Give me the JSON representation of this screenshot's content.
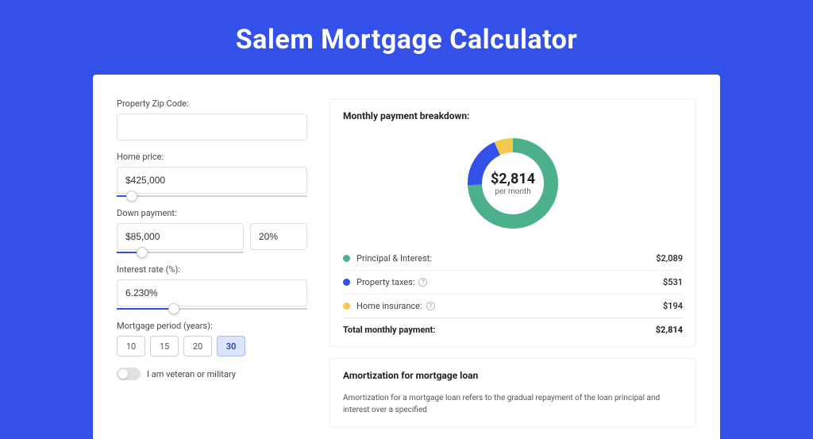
{
  "title": "Salem Mortgage Calculator",
  "colors": {
    "principal": "#4CB08A",
    "taxes": "#3350E8",
    "insurance": "#F3C94B"
  },
  "form": {
    "zip_label": "Property Zip Code:",
    "zip_value": "",
    "price_label": "Home price:",
    "price_value": "$425,000",
    "price_slider_pct": 8,
    "down_label": "Down payment:",
    "down_value": "$85,000",
    "down_pct_value": "20%",
    "down_slider_pct": 20,
    "rate_label": "Interest rate (%):",
    "rate_value": "6.230%",
    "rate_slider_pct": 30,
    "period_label": "Mortgage period (years):",
    "periods": [
      "10",
      "15",
      "20",
      "30"
    ],
    "period_selected": "30",
    "veteran_label": "I am veteran or military"
  },
  "breakdown": {
    "title": "Monthly payment breakdown:",
    "total_display": "$2,814",
    "per_month_label": "per month",
    "items": [
      {
        "label": "Principal & Interest:",
        "value_display": "$2,089",
        "value": 2089,
        "color_key": "principal",
        "has_info": false
      },
      {
        "label": "Property taxes:",
        "value_display": "$531",
        "value": 531,
        "color_key": "taxes",
        "has_info": true
      },
      {
        "label": "Home insurance:",
        "value_display": "$194",
        "value": 194,
        "color_key": "insurance",
        "has_info": true
      }
    ],
    "total_label": "Total monthly payment:"
  },
  "amortization": {
    "title": "Amortization for mortgage loan",
    "text": "Amortization for a mortgage loan refers to the gradual repayment of the loan principal and interest over a specified"
  },
  "chart_data": {
    "type": "pie",
    "title": "Monthly payment breakdown",
    "series": [
      {
        "name": "Principal & Interest",
        "value": 2089
      },
      {
        "name": "Property taxes",
        "value": 531
      },
      {
        "name": "Home insurance",
        "value": 194
      }
    ],
    "total": 2814
  }
}
